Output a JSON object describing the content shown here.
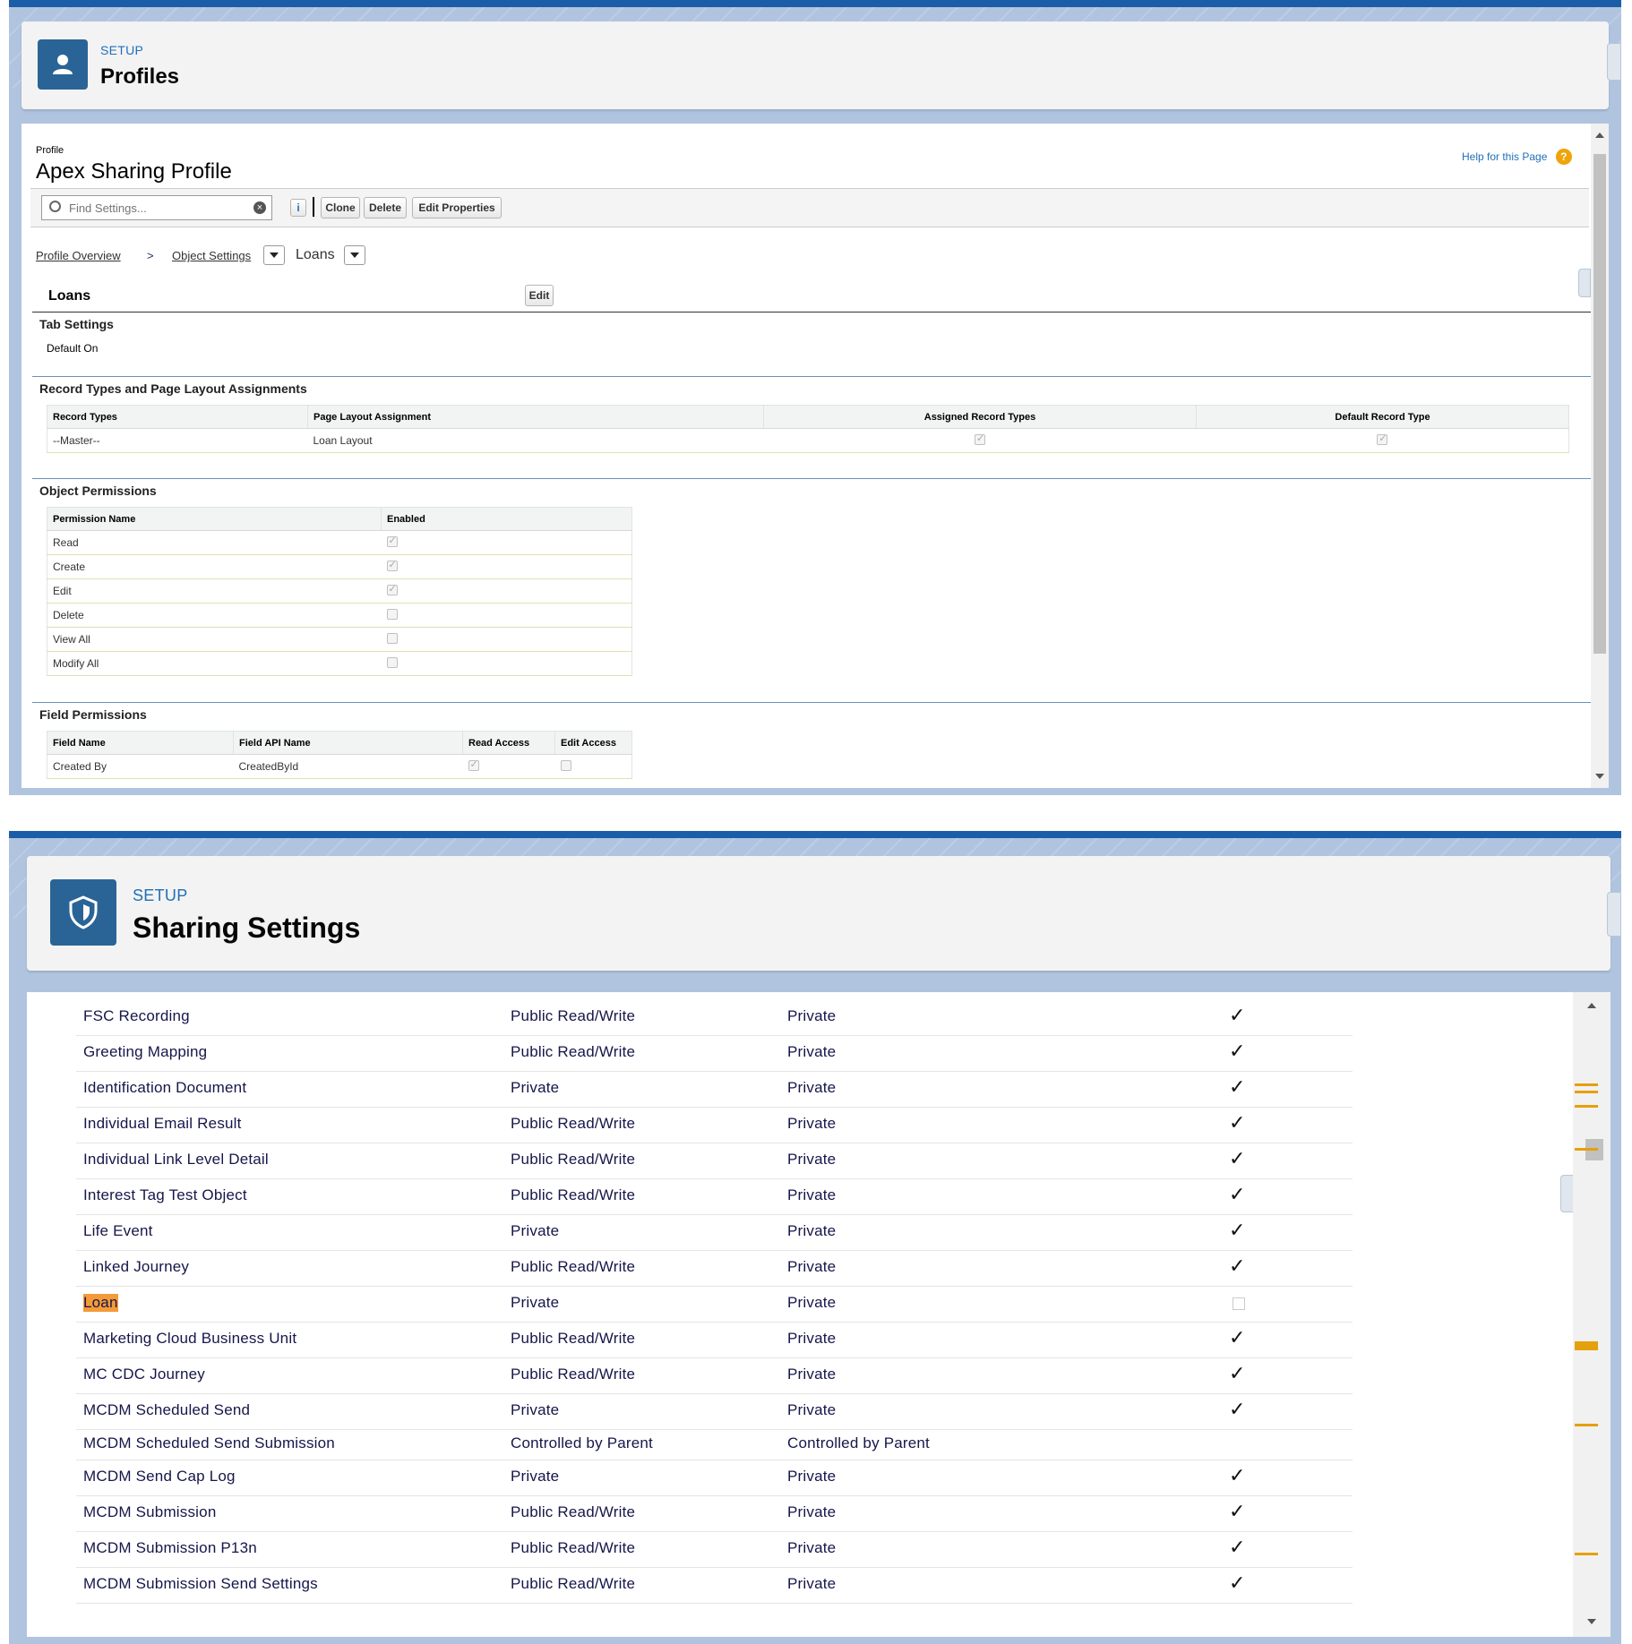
{
  "profiles": {
    "setup_label": "SETUP",
    "title": "Profiles",
    "profile_label": "Profile",
    "profile_name": "Apex Sharing Profile",
    "help_link": "Help for this Page",
    "search": {
      "placeholder": "Find Settings..."
    },
    "toolbar": {
      "info": "i",
      "clone": "Clone",
      "delete": "Delete",
      "edit_properties": "Edit Properties"
    },
    "breadcrumb": {
      "overview": "Profile Overview",
      "separator": ">",
      "object_settings": "Object Settings",
      "current": "Loans"
    },
    "object": {
      "name": "Loans",
      "edit": "Edit"
    },
    "tab_settings": {
      "title": "Tab Settings",
      "value": "Default On"
    },
    "record_types": {
      "title": "Record Types and Page Layout Assignments",
      "headers": [
        "Record Types",
        "Page Layout Assignment",
        "Assigned Record Types",
        "Default Record Type"
      ],
      "rows": [
        {
          "type": "--Master--",
          "layout": "Loan Layout",
          "assigned": true,
          "default": true
        }
      ]
    },
    "object_permissions": {
      "title": "Object Permissions",
      "headers": [
        "Permission Name",
        "Enabled"
      ],
      "rows": [
        {
          "name": "Read",
          "enabled": true
        },
        {
          "name": "Create",
          "enabled": true
        },
        {
          "name": "Edit",
          "enabled": true
        },
        {
          "name": "Delete",
          "enabled": false
        },
        {
          "name": "View All",
          "enabled": false
        },
        {
          "name": "Modify All",
          "enabled": false
        }
      ]
    },
    "field_permissions": {
      "title": "Field Permissions",
      "headers": [
        "Field Name",
        "Field API Name",
        "Read Access",
        "Edit Access"
      ],
      "rows": [
        {
          "field": "Created By",
          "api": "CreatedById",
          "read": true,
          "edit": false
        }
      ]
    }
  },
  "sharing": {
    "setup_label": "SETUP",
    "title": "Sharing Settings",
    "rows": [
      {
        "object": "FSC Recording",
        "internal": "Public Read/Write",
        "external": "Private",
        "check": "✓"
      },
      {
        "object": "Greeting Mapping",
        "internal": "Public Read/Write",
        "external": "Private",
        "check": "✓"
      },
      {
        "object": "Identification Document",
        "internal": "Private",
        "external": "Private",
        "check": "✓"
      },
      {
        "object": "Individual Email Result",
        "internal": "Public Read/Write",
        "external": "Private",
        "check": "✓"
      },
      {
        "object": "Individual Link Level Detail",
        "internal": "Public Read/Write",
        "external": "Private",
        "check": "✓"
      },
      {
        "object": "Interest Tag Test Object",
        "internal": "Public Read/Write",
        "external": "Private",
        "check": "✓"
      },
      {
        "object": "Life Event",
        "internal": "Private",
        "external": "Private",
        "check": "✓"
      },
      {
        "object": "Linked Journey",
        "internal": "Public Read/Write",
        "external": "Private",
        "check": "✓"
      },
      {
        "object": "Loan",
        "internal": "Private",
        "external": "Private",
        "check": "",
        "highlight": true
      },
      {
        "object": "Marketing Cloud Business Unit",
        "internal": "Public Read/Write",
        "external": "Private",
        "check": "✓"
      },
      {
        "object": "MC CDC Journey",
        "internal": "Public Read/Write",
        "external": "Private",
        "check": "✓"
      },
      {
        "object": "MCDM Scheduled Send",
        "internal": "Private",
        "external": "Private",
        "check": "✓"
      },
      {
        "object": "MCDM Scheduled Send Submission",
        "internal": "Controlled by Parent",
        "external": "Controlled by Parent",
        "check": ""
      },
      {
        "object": "MCDM Send Cap Log",
        "internal": "Private",
        "external": "Private",
        "check": "✓"
      },
      {
        "object": "MCDM Submission",
        "internal": "Public Read/Write",
        "external": "Private",
        "check": "✓"
      },
      {
        "object": "MCDM Submission P13n",
        "internal": "Public Read/Write",
        "external": "Private",
        "check": "✓"
      },
      {
        "object": "MCDM Submission Send Settings",
        "internal": "Public Read/Write",
        "external": "Private",
        "check": "✓"
      }
    ]
  },
  "colors": {
    "brand": "#1b5ea7",
    "icon_tile": "#2a6496",
    "highlight": "#f49a39",
    "search_mark": "#e5a00d"
  },
  "icons": [
    "user-icon",
    "shield-icon",
    "search-icon",
    "clear-icon",
    "help-icon",
    "chevron-down-icon",
    "checkmark-icon"
  ]
}
